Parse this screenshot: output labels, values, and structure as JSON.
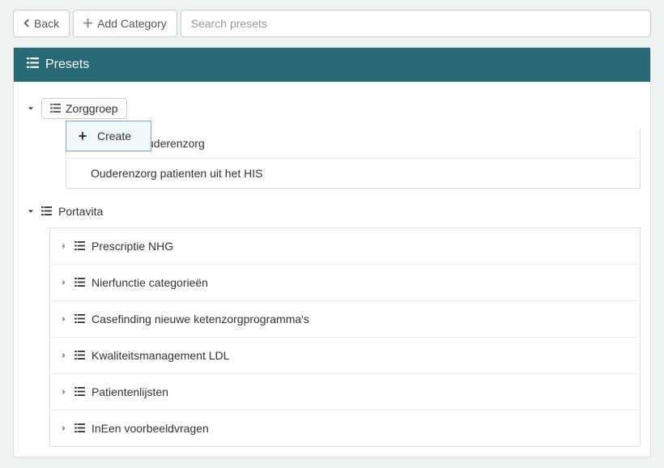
{
  "toolbar": {
    "back_label": "Back",
    "add_category_label": "Add Category",
    "search_placeholder": "Search presets"
  },
  "panel": {
    "title": "Presets"
  },
  "context_menu": {
    "create_label": "Create"
  },
  "tree": {
    "nodes": [
      {
        "label": "Zorggroep",
        "expanded": true,
        "styled": true,
        "children": [
          {
            "label": "uderenzorg",
            "partially_hidden": true
          },
          {
            "label": "Ouderenzorg patienten uit het HIS"
          }
        ]
      },
      {
        "label": "Portavita",
        "expanded": true,
        "styled": false,
        "children": [
          {
            "label": "Prescriptie NHG",
            "expandable": true
          },
          {
            "label": "Nierfunctie categorieën",
            "expandable": true
          },
          {
            "label": "Casefinding nieuwe ketenzorgprogramma's",
            "expandable": true
          },
          {
            "label": "Kwaliteitsmanagement LDL",
            "expandable": true
          },
          {
            "label": "Patientenlijsten",
            "expandable": true
          },
          {
            "label": "InEen voorbeeldvragen",
            "expandable": true
          }
        ]
      }
    ]
  }
}
